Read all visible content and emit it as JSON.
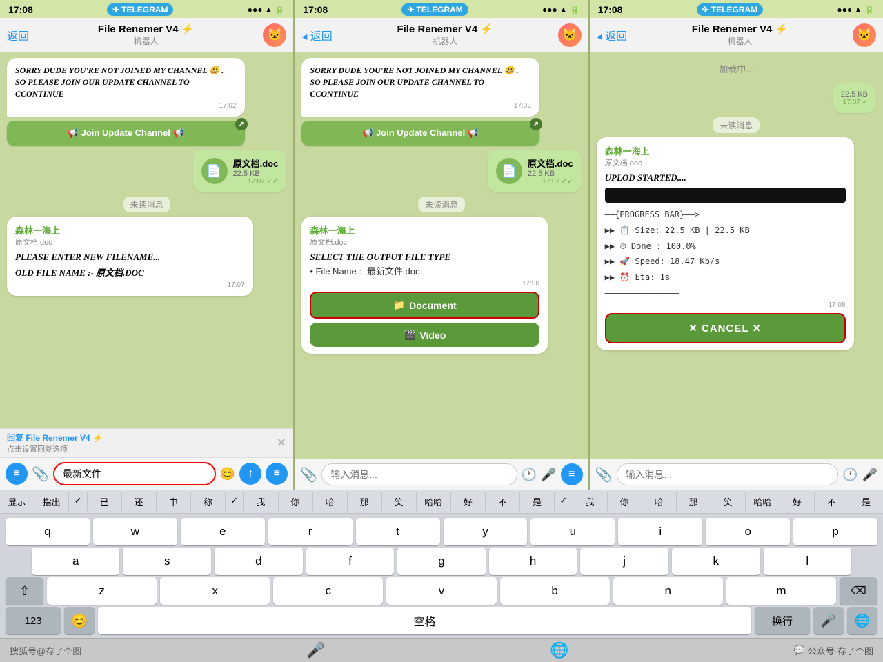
{
  "panels": [
    {
      "id": "panel1",
      "status": {
        "time": "17:08",
        "network": "●●●●",
        "wifi": "WiFi",
        "battery": "■■■"
      },
      "telegram_label": "TELEGRAM",
      "header": {
        "back": "返回",
        "title": "File Renemer V4 ⚡",
        "subtitle": "机器人"
      },
      "messages": [
        {
          "type": "left-bubble",
          "text": "Sorry Dude You'Re Not Joined My Channel 😃 . So Please Join Our Update Channel To Ccontinue",
          "time": "17:02"
        },
        {
          "type": "join-btn",
          "label": "📢 Join Update Channel 📢"
        },
        {
          "type": "file-bubble",
          "name": "原文档.doc",
          "size": "22.5 KB",
          "time": "17:07",
          "check": "✓✓"
        },
        {
          "type": "unread",
          "text": "未读消息"
        },
        {
          "type": "message-card",
          "sender": "森林一海上",
          "sender_file": "原文档.doc",
          "title": "Please Enter New Filename...",
          "old_name": "Old File Name :- 原文档.doc",
          "time": "17:07"
        }
      ],
      "reply_bar": {
        "label": "回复 File Renemer V4 ⚡",
        "sublabel": "点击设置回复选项"
      },
      "input": {
        "value": "最新文件",
        "placeholder": "输入消息...",
        "highlighted": true
      }
    },
    {
      "id": "panel2",
      "status": {
        "time": "17:08",
        "network": "●●●●",
        "wifi": "WiFi",
        "battery": "■■■"
      },
      "telegram_label": "TELEGRAM",
      "header": {
        "back": "返回",
        "title": "File Renemer V4 ⚡",
        "subtitle": "机器人"
      },
      "messages": [
        {
          "type": "left-bubble",
          "text": "Sorry Dude You'Re Not Joined My Channel 😃 . So Please Join Our Update Channel To Ccontinue",
          "time": "17:02"
        },
        {
          "type": "join-btn",
          "label": "📢 Join Update Channel 📢"
        },
        {
          "type": "file-bubble",
          "name": "原文档.doc",
          "size": "22.5 KB",
          "time": "17:07",
          "check": "✓✓"
        },
        {
          "type": "unread",
          "text": "未读消息"
        },
        {
          "type": "action-card",
          "sender": "森林一海上",
          "sender_file": "原文档.doc",
          "title": "Select The Output File Type",
          "subtitle": "• File Name :- 最新文件.doc",
          "time": "17:08",
          "btn_doc": "📁 Document",
          "btn_video": "🎬 Video"
        }
      ],
      "input": {
        "value": "",
        "placeholder": "输入消息...",
        "highlighted": false
      }
    },
    {
      "id": "panel3",
      "status": {
        "time": "17:08",
        "network": "●●●●",
        "wifi": "WiFi",
        "battery": "■■■"
      },
      "telegram_label": "TELEGRAM",
      "header": {
        "back": "返回",
        "title": "File Renemer V4 ⚡",
        "subtitle": "机器人"
      },
      "messages": [
        {
          "type": "loading",
          "text": "加载中..."
        },
        {
          "type": "file-bubble",
          "name": "",
          "size": "22.5 KB",
          "time": "17:07",
          "check": "✓"
        },
        {
          "type": "unread",
          "text": "未读消息"
        },
        {
          "type": "progress-card",
          "sender": "森林一海上",
          "sender_file": "原文档.doc",
          "title": "Uplod Started....",
          "progress_label": "——{PROGRESS BAR}——>",
          "size_line": "Size: 22.5 KB | 22.5 KB",
          "done_line": "Done : 100.0%",
          "speed_line": "Speed: 18.47 Kb/s",
          "eta_line": "Eta: 1s",
          "time": "17:08",
          "cancel_btn": "✕ CANCEL ✕"
        }
      ],
      "input": {
        "value": "",
        "placeholder": "输入消息...",
        "highlighted": false
      }
    }
  ],
  "keyboard": {
    "suggestions": [
      "显示",
      "指出",
      "已",
      "还",
      "中",
      "称",
      "✓",
      "我",
      "你",
      "哈",
      "那",
      "笑",
      "哈哈",
      "好",
      "不",
      "是",
      "✓",
      "我",
      "你",
      "哈",
      "那",
      "笑",
      "哈哈",
      "好",
      "不",
      "是"
    ],
    "rows": [
      [
        "q",
        "w",
        "e",
        "r",
        "t",
        "y",
        "u",
        "i",
        "o",
        "p"
      ],
      [
        "a",
        "s",
        "d",
        "f",
        "g",
        "h",
        "j",
        "k",
        "l"
      ],
      [
        "⇧",
        "z",
        "x",
        "c",
        "v",
        "b",
        "n",
        "m",
        "⌫"
      ],
      [
        "123",
        "😊",
        "空格",
        "换行"
      ]
    ]
  },
  "watermarks": {
    "left": "搜狐号@存了个图",
    "right": "公众号·存了个图"
  }
}
